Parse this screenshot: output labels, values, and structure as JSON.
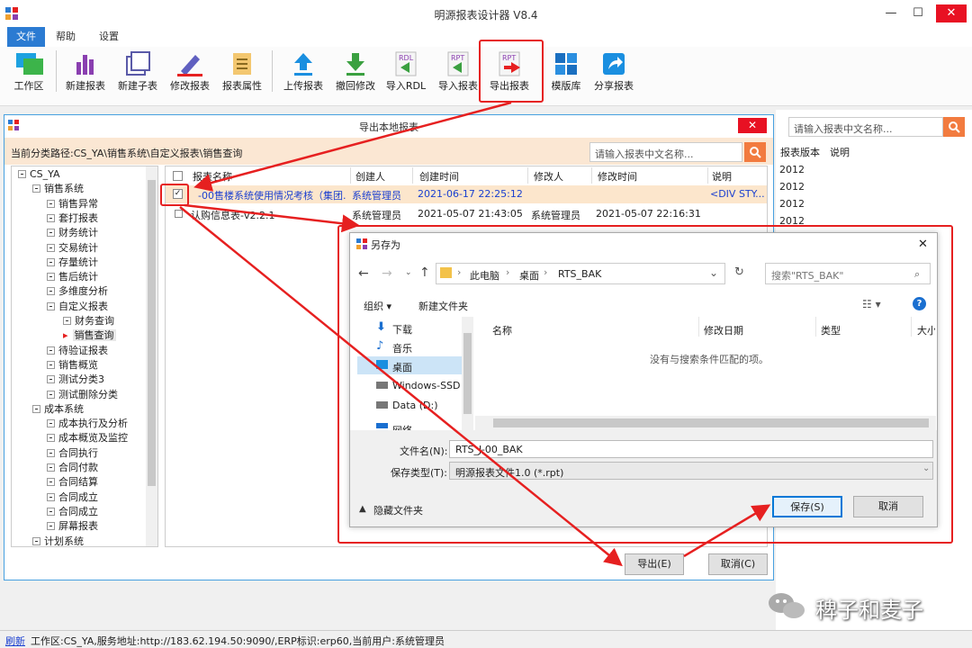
{
  "app": {
    "title": "明源报表设计器 V8.4"
  },
  "window_buttons": {
    "minimize": "—",
    "maximize": "☐",
    "close": "✕"
  },
  "menu_tabs": [
    "文件",
    "帮助",
    "设置"
  ],
  "toolbar": [
    "工作区",
    "新建报表",
    "新建子表",
    "修改报表",
    "报表属性",
    "上传报表",
    "撤回修改",
    "导入RDL",
    "导入报表",
    "导出报表",
    "模版库",
    "分享报表"
  ],
  "toolbar_icon_text": {
    "rdl": "RDL",
    "rpt1": "RPT",
    "rpt2": "RPT"
  },
  "export_dialog": {
    "title": "导出本地报表",
    "close": "✕",
    "path": "当前分类路径:CS_YA\\销售系统\\自定义报表\\销售查询",
    "search_placeholder": "请输入报表中文名称...",
    "search_icon": "search-icon",
    "tree": [
      {
        "label": "CS_YA",
        "level": 0
      },
      {
        "label": "销售系统",
        "level": 1
      },
      {
        "label": "销售异常",
        "level": 2
      },
      {
        "label": "套打报表",
        "level": 2
      },
      {
        "label": "财务统计",
        "level": 2
      },
      {
        "label": "交易统计",
        "level": 2
      },
      {
        "label": "存量统计",
        "level": 2
      },
      {
        "label": "售后统计",
        "level": 2
      },
      {
        "label": "多维度分析",
        "level": 2
      },
      {
        "label": "自定义报表",
        "level": 2
      },
      {
        "label": "财务查询",
        "level": 3
      },
      {
        "label": "销售查询",
        "level": 3,
        "selected": true
      },
      {
        "label": "待验证报表",
        "level": 2
      },
      {
        "label": "销售概览",
        "level": 2
      },
      {
        "label": "测试分类3",
        "level": 2
      },
      {
        "label": "测试删除分类",
        "level": 2
      },
      {
        "label": "成本系统",
        "level": 1
      },
      {
        "label": "成本执行及分析",
        "level": 2
      },
      {
        "label": "成本概览及监控",
        "level": 2
      },
      {
        "label": "合同执行",
        "level": 2
      },
      {
        "label": "合同付款",
        "level": 2
      },
      {
        "label": "合同结算",
        "level": 2
      },
      {
        "label": "合同成立",
        "level": 2
      },
      {
        "label": "合同成立",
        "level": 2
      },
      {
        "label": "屏幕报表",
        "level": 2
      },
      {
        "label": "计划系统",
        "level": 1
      }
    ],
    "columns": [
      "报表名称",
      "创建人",
      "创建时间",
      "修改人",
      "修改时间",
      "说明"
    ],
    "rows": [
      {
        "checked": true,
        "name": "-00售楼系统使用情况考核（集团...",
        "creator": "系统管理员",
        "created": "2021-06-17 22:25:12",
        "modifier": "",
        "modified": "",
        "note": "<DIV STY..."
      },
      {
        "checked": false,
        "name": "认购信息表-v2.2.1",
        "creator": "系统管理员",
        "created": "2021-05-07 21:43:05",
        "modifier": "系统管理员",
        "modified": "2021-05-07 22:16:31",
        "note": ""
      }
    ],
    "export_button": "导出(E)",
    "cancel_button": "取消(C)"
  },
  "right_panel": {
    "search_placeholder": "请输入报表中文名称...",
    "columns": [
      "报表版本",
      "说明"
    ],
    "versions": [
      "2012",
      "2012",
      "2012",
      "2012"
    ]
  },
  "save_dialog": {
    "title": "另存为",
    "close": "✕",
    "breadcrumb": [
      "此电脑",
      "桌面",
      "RTS_BAK"
    ],
    "search_placeholder": "搜索\"RTS_BAK\"",
    "organize": "组织 ▾",
    "new_folder": "新建文件夹",
    "nav_items": [
      "下载",
      "音乐",
      "桌面",
      "Windows-SSD (",
      "Data (D:)",
      "网络"
    ],
    "columns": [
      "名称",
      "修改日期",
      "类型",
      "大小"
    ],
    "empty_message": "没有与搜索条件匹配的项。",
    "filename_label": "文件名(N):",
    "filename_value": "RTS_J-00_BAK",
    "filetype_label": "保存类型(T):",
    "filetype_value": "明源报表文件1.0 (*.rpt)",
    "hide_folders": "隐藏文件夹",
    "save_button": "保存(S)",
    "cancel_button": "取消"
  },
  "status_bar": {
    "refresh": "刷新",
    "text": "工作区:CS_YA,服务地址:http://183.62.194.50:9090/,ERP标识:erp60,当前用户:系统管理员"
  },
  "watermark": "稗子和麦子",
  "colors": {
    "accent": "#2b7bd2",
    "highlight_row": "#fce6cc",
    "annotation_red": "#e62020",
    "search_button": "#f27b3f"
  }
}
